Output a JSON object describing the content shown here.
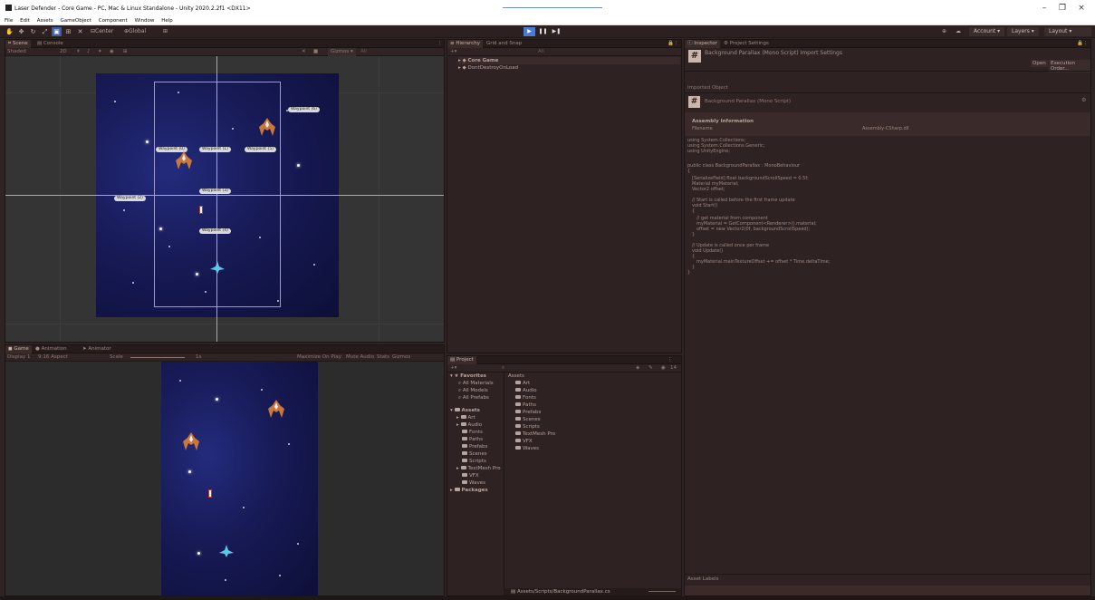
{
  "window": {
    "title": "Laser Defender - Core Game - PC, Mac & Linux Standalone - Unity 2020.2.2f1 <DX11>"
  },
  "menu": [
    "File",
    "Edit",
    "Assets",
    "GameObject",
    "Component",
    "Window",
    "Help"
  ],
  "toolbar": {
    "center_label": "Center",
    "global_label": "Global",
    "account_label": "Account",
    "layers_label": "Layers",
    "layout_label": "Layout"
  },
  "scene": {
    "tabs": [
      "Scene",
      "Console"
    ],
    "shading_mode": "Shaded",
    "mode_2d": "2D",
    "gizmos_label": "Gizmos",
    "search_placeholder": "All",
    "waypoints": [
      "Waypoint (0)",
      "Waypoint (1)",
      "Waypoint (2)",
      "Waypoint (3)",
      "Waypoint (4)",
      "Waypoint (5)",
      "Waypoint (6)"
    ]
  },
  "game": {
    "tabs": [
      "Game",
      "Animation",
      "Animator"
    ],
    "display": "Display 1",
    "aspect": "9:16 Aspect",
    "scale_label": "Scale",
    "scale_value": "1x",
    "options": [
      "Maximize On Play",
      "Mute Audio",
      "Stats",
      "Gizmos"
    ]
  },
  "hierarchy": {
    "tabs": [
      "Hierarchy",
      "Grid and Snap"
    ],
    "search_placeholder": "All",
    "items": [
      "Core Game",
      "DontDestroyOnLoad"
    ]
  },
  "project": {
    "tab": "Project",
    "item_count": "14",
    "favorites_label": "Favorites",
    "favorites": [
      "All Materials",
      "All Models",
      "All Prefabs"
    ],
    "assets_label": "Assets",
    "asset_folders": [
      "Art",
      "Audio",
      "Fonts",
      "Paths",
      "Prefabs",
      "Scenes",
      "Scripts",
      "TextMesh Pro",
      "VFX",
      "Waves"
    ],
    "packages_label": "Packages",
    "grid_header": "Assets",
    "grid_items": [
      "Art",
      "Audio",
      "Fonts",
      "Paths",
      "Prefabs",
      "Scenes",
      "Scripts",
      "TextMesh Pro",
      "VFX",
      "Waves"
    ],
    "footer_path": "Assets/Scripts/BackgroundParallax.cs"
  },
  "inspector": {
    "tabs": [
      "Inspector",
      "Project Settings"
    ],
    "title": "Background Parallax (Mono Script) Import Settings",
    "open_button": "Open",
    "exec_order_button": "Execution Order...",
    "imported_object": "Imported Object",
    "object_name": "Background Parallax (Mono Script)",
    "assembly_info": "Assembly Information",
    "filename_label": "Filename",
    "filename_value": "Assembly-CSharp.dll",
    "code": [
      "using System.Collections;",
      "using System.Collections.Generic;",
      "using UnityEngine;",
      "",
      "public class BackgroundParallax : MonoBehaviour",
      "{",
      "    [SerializeField] float backgroundScrollSpeed = 0.5f;",
      "    Material myMaterial;",
      "    Vector2 offset;",
      "",
      "    // Start is called before the first frame update",
      "    void Start()",
      "    {",
      "        // get material from component",
      "        myMaterial = GetComponent<Renderer>().material;",
      "        offset = new Vector2(0f, backgroundScrollSpeed);",
      "    }",
      "",
      "    // Update is called once per frame",
      "    void Update()",
      "    {",
      "        myMaterial.mainTextureOffset += offset * Time.deltaTime;",
      "    }",
      "}"
    ],
    "asset_labels": "Asset Labels"
  }
}
